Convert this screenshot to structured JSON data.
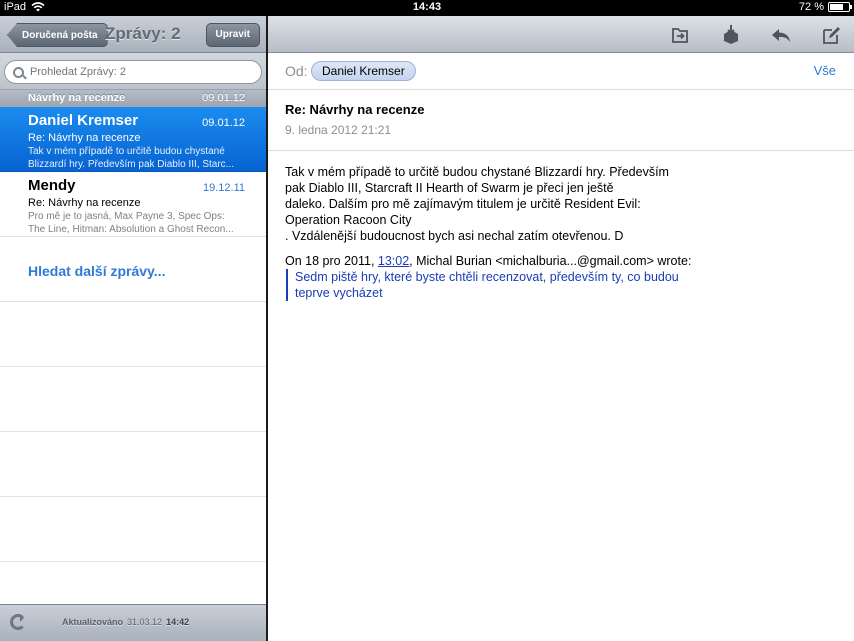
{
  "status_bar": {
    "device": "iPad",
    "time": "14:43",
    "battery": "72 %",
    "battery_level": 0.72
  },
  "list_pane": {
    "back_label": "Doručená pošta",
    "title": "Zprávy: 2",
    "edit_label": "Upravit",
    "search_placeholder": "Prohledat Zprávy: 2",
    "thread_header": {
      "subject": "Návrhy na recenze",
      "date": "09.01.12"
    },
    "messages": [
      {
        "from": "Daniel Kremser",
        "date": "09.01.12",
        "subject": "Re: Návrhy na recenze",
        "preview_1": "Tak v mém případě to určitě budou chystané",
        "preview_2": "Blizzardí hry. Především pak Diablo III, Starc..."
      },
      {
        "from": "Mendy",
        "date": "19.12.11",
        "subject": "Re: Návrhy na recenze",
        "preview_1": "Pro mě je to jasná, Max Payne 3, Spec Ops:",
        "preview_2": "The Line, Hitman: Absolution a Ghost Recon..."
      }
    ],
    "load_more": "Hledat další zprávy...",
    "footer": {
      "label": "Aktualizováno",
      "date": "31.03.12",
      "time": "14:42"
    }
  },
  "detail_pane": {
    "toolbar_icons": [
      "move-to-folder-icon",
      "archive-icon",
      "reply-icon",
      "compose-icon"
    ],
    "from_label": "Od:",
    "from_name": "Daniel Kremser",
    "all_label": "Vše",
    "subject": "Re: Návrhy na recenze",
    "datetime": "9. ledna 2012 21:21",
    "body_lines": [
      "Tak v mém případě to určitě budou chystané Blizzardí hry. Především",
      "pak Diablo III, Starcraft II Hearth of Swarm je přeci jen ještě",
      "daleko. Dalším pro mě zajímavým titulem je určitě Resident Evil:",
      "Operation Racoon City",
      ". Vzdálenější budoucnost bych asi nechal zatím otevřenou. D"
    ],
    "quote_prefix": "On 18 pro 2011, ",
    "quote_time": "13:02",
    "quote_suffix": ", Michal Burian <michalburia...@gmail.com> wrote:",
    "quote_lines": [
      "Sedm piště hry, které byste chtěli recenzovat, především ty, co budou",
      "teprve vycházet"
    ]
  }
}
